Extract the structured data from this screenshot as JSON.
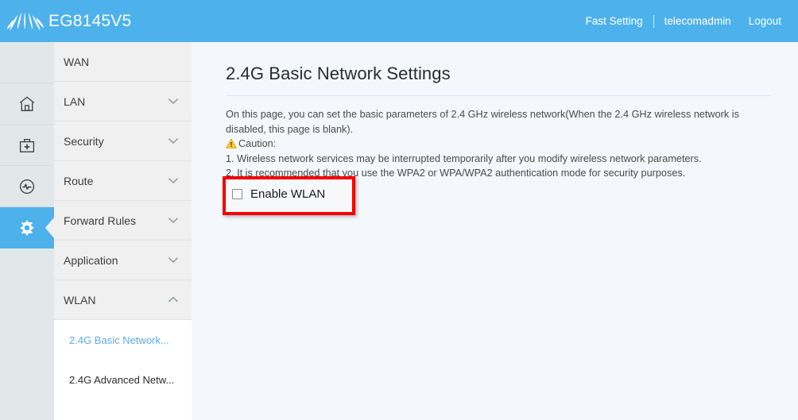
{
  "header": {
    "brand_name": "EG8145V5",
    "logo_icon": "huawei-flower-logo",
    "fast_setting": "Fast Setting",
    "user": "telecomadmin",
    "logout": "Logout",
    "background_color": "#4db2ec"
  },
  "rail": {
    "items": [
      {
        "icon": "blank",
        "label": "",
        "active": false
      },
      {
        "icon": "home-icon",
        "label": "Home",
        "active": false
      },
      {
        "icon": "first-aid-kit-icon",
        "label": "Maintenance",
        "active": false
      },
      {
        "icon": "gauge-monitor-icon",
        "label": "Status",
        "active": false
      },
      {
        "icon": "gear-icon",
        "label": "Advanced",
        "active": true
      }
    ],
    "active_color": "#4db2ec",
    "background_color": "#e2e8ea"
  },
  "nav": {
    "items": [
      {
        "label": "WAN",
        "chevron": "none",
        "expanded": false
      },
      {
        "label": "LAN",
        "chevron": "chevron-down-icon",
        "expanded": false
      },
      {
        "label": "Security",
        "chevron": "chevron-down-icon",
        "expanded": false
      },
      {
        "label": "Route",
        "chevron": "chevron-down-icon",
        "expanded": false
      },
      {
        "label": "Forward Rules",
        "chevron": "chevron-down-icon",
        "expanded": false
      },
      {
        "label": "Application",
        "chevron": "chevron-down-icon",
        "expanded": false
      },
      {
        "label": "WLAN",
        "chevron": "chevron-up-icon",
        "expanded": true
      }
    ],
    "sub_items": [
      {
        "label": "2.4G Basic Network...",
        "active": true
      },
      {
        "label": "2.4G Advanced Netw...",
        "active": false
      }
    ],
    "active_link_color": "#5cacee"
  },
  "main": {
    "title": "2.4G Basic Network Settings",
    "description_line_1": "On this page, you can set the basic parameters of 2.4 GHz wireless network(When the 2.4 GHz wireless network is disabled, this page is blank).",
    "caution_icon": "warning-triangle-icon",
    "caution_label": "Caution:",
    "caution_item_1": "1. Wireless network services may be interrupted temporarily after you modify wireless network parameters.",
    "caution_item_2": "2. It is recommended that you use the WPA2 or WPA/WPA2 authentication mode for security purposes.",
    "enable_wlan_label": "Enable WLAN",
    "enable_wlan_checked": false,
    "highlight_color": "#f40000"
  }
}
